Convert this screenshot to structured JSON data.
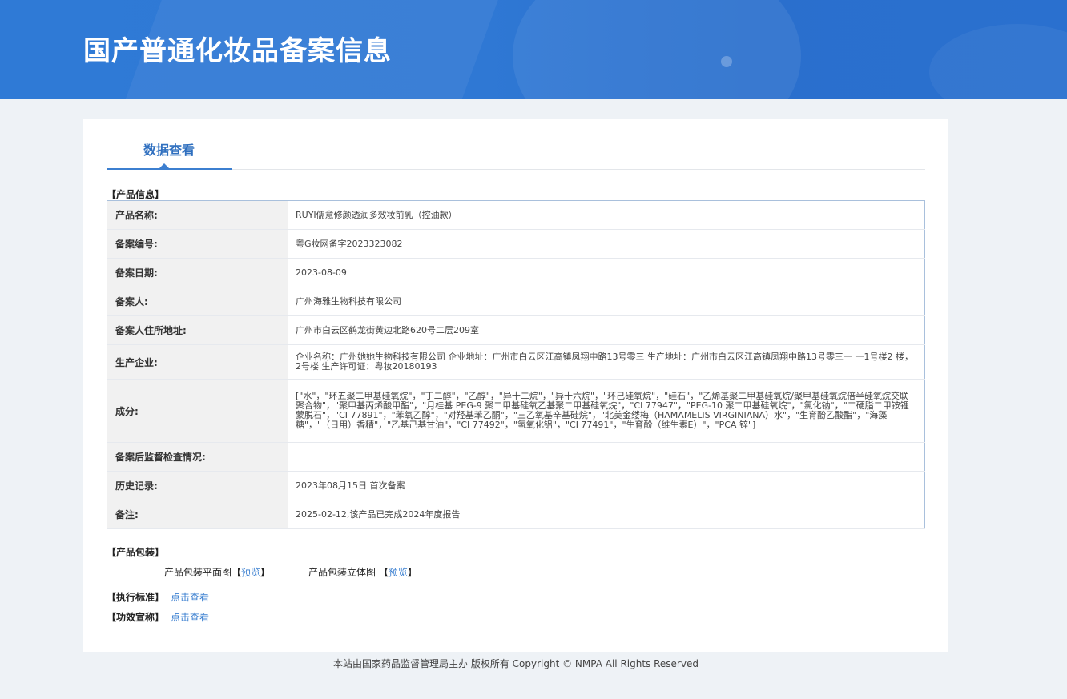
{
  "header": {
    "title": "国产普通化妆品备案信息"
  },
  "tabs": [
    {
      "label": "数据查看"
    }
  ],
  "product_info": {
    "section_label": "【产品信息】",
    "rows": [
      {
        "key": "产品名称:",
        "value": "RUYI儒意修颜透润多效妆前乳（控油款）"
      },
      {
        "key": "备案编号:",
        "value": "粤G妆网备字2023323082"
      },
      {
        "key": "备案日期:",
        "value": "2023-08-09"
      },
      {
        "key": "备案人:",
        "value": "广州海雅生物科技有限公司"
      },
      {
        "key": "备案人住所地址:",
        "value": "广州市白云区鹤龙街黄边北路620号二层209室"
      },
      {
        "key": "生产企业:",
        "value": "企业名称：广州她她生物科技有限公司 企业地址：广州市白云区江高镇凤翔中路13号零三 生产地址：广州市白云区江高镇凤翔中路13号零三一 一1号楼2 楼，2号楼 生产许可证：粤妆20180193"
      },
      {
        "key": "成分:",
        "value": "[\"水\"，\"环五聚二甲基硅氧烷\"，\"丁二醇\"，\"乙醇\"，\"异十二烷\"，\"异十六烷\"，\"环己硅氧烷\"，\"硅石\"，\"乙烯基聚二甲基硅氧烷/聚甲基硅氧烷倍半硅氧烷交联聚合物\"，\"聚甲基丙烯酸甲酯\"，\"月桂基 PEG-9 聚二甲基硅氧乙基聚二甲基硅氧烷\"，\"CI 77947\"，\"PEG-10 聚二甲基硅氧烷\"，\"氯化钠\"，\"二硬脂二甲铵锂蒙脱石\"，\"CI 77891\"，\"苯氧乙醇\"，\"对羟基苯乙酮\"，\"三乙氧基辛基硅烷\"，\"北美金缕梅（HAMAMELIS VIRGINIANA）水\"，\"生育酚乙酸酯\"，\"海藻糖\"，\"（日用）香精\"，\"乙基己基甘油\"，\"CI 77492\"，\"氢氧化铝\"，\"CI 77491\"，\"生育酚（维生素E）\"，\"PCA 锌\"]"
      },
      {
        "key": "备案后监督检查情况:",
        "value": ""
      },
      {
        "key": "历史记录:",
        "value": "2023年08月15日 首次备案"
      },
      {
        "key": "备注:",
        "value": "2025-02-12,该产品已完成2024年度报告"
      }
    ]
  },
  "packaging": {
    "section_label": "【产品包装】",
    "flat_label": "产品包装平面图",
    "solid_label": "产品包装立体图",
    "preview_link": "预览",
    "bracket_open": "【",
    "bracket_close": "】"
  },
  "standard": {
    "label": "【执行标准】",
    "link": "点击查看"
  },
  "efficacy": {
    "label": "【功效宣称】",
    "link": "点击查看"
  },
  "footer": {
    "text": "本站由国家药品监督管理局主办 版权所有 Copyright © NMPA All Rights Reserved"
  }
}
